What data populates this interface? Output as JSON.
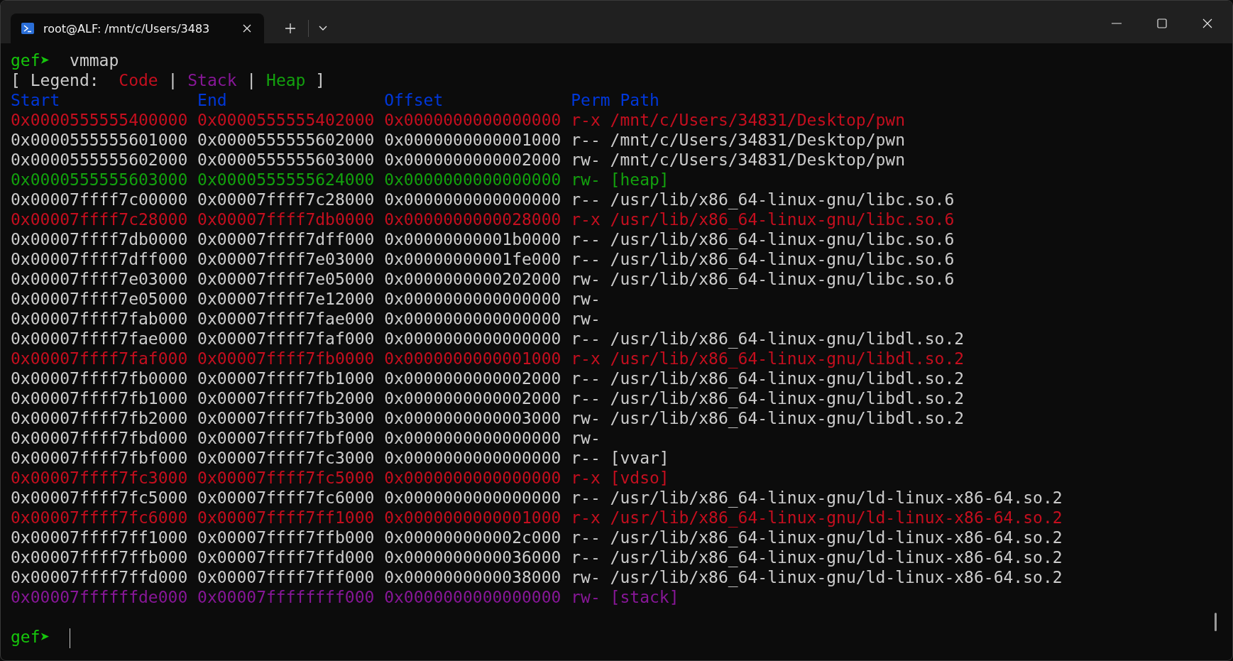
{
  "tab": {
    "title": "root@ALF: /mnt/c/Users/3483",
    "selected": true
  },
  "terminal": {
    "command_line": {
      "prompt": "gef➤",
      "command": "vmmap"
    },
    "legend": [
      {
        "text": "[ Legend:",
        "kind": "plain"
      },
      {
        "text": "Code",
        "kind": "code"
      },
      {
        "text": "|",
        "kind": "plain"
      },
      {
        "text": "Stack",
        "kind": "stack"
      },
      {
        "text": "|",
        "kind": "plain"
      },
      {
        "text": "Heap",
        "kind": "heap"
      },
      {
        "text": "]",
        "kind": "plain"
      }
    ],
    "columns": [
      "Start",
      "End",
      "Offset",
      "Perm",
      "Path"
    ],
    "rows": [
      {
        "start": "0x0000555555400000",
        "end": "0x0000555555402000",
        "offset": "0x0000000000000000",
        "perm": "r-x",
        "path": "/mnt/c/Users/34831/Desktop/pwn",
        "kind": "code"
      },
      {
        "start": "0x0000555555601000",
        "end": "0x0000555555602000",
        "offset": "0x0000000000001000",
        "perm": "r--",
        "path": "/mnt/c/Users/34831/Desktop/pwn",
        "kind": "plain"
      },
      {
        "start": "0x0000555555602000",
        "end": "0x0000555555603000",
        "offset": "0x0000000000002000",
        "perm": "rw-",
        "path": "/mnt/c/Users/34831/Desktop/pwn",
        "kind": "plain"
      },
      {
        "start": "0x0000555555603000",
        "end": "0x0000555555624000",
        "offset": "0x0000000000000000",
        "perm": "rw-",
        "path": "[heap]",
        "kind": "heap"
      },
      {
        "start": "0x00007ffff7c00000",
        "end": "0x00007ffff7c28000",
        "offset": "0x0000000000000000",
        "perm": "r--",
        "path": "/usr/lib/x86_64-linux-gnu/libc.so.6",
        "kind": "plain"
      },
      {
        "start": "0x00007ffff7c28000",
        "end": "0x00007ffff7db0000",
        "offset": "0x0000000000028000",
        "perm": "r-x",
        "path": "/usr/lib/x86_64-linux-gnu/libc.so.6",
        "kind": "code"
      },
      {
        "start": "0x00007ffff7db0000",
        "end": "0x00007ffff7dff000",
        "offset": "0x00000000001b0000",
        "perm": "r--",
        "path": "/usr/lib/x86_64-linux-gnu/libc.so.6",
        "kind": "plain"
      },
      {
        "start": "0x00007ffff7dff000",
        "end": "0x00007ffff7e03000",
        "offset": "0x00000000001fe000",
        "perm": "r--",
        "path": "/usr/lib/x86_64-linux-gnu/libc.so.6",
        "kind": "plain"
      },
      {
        "start": "0x00007ffff7e03000",
        "end": "0x00007ffff7e05000",
        "offset": "0x0000000000202000",
        "perm": "rw-",
        "path": "/usr/lib/x86_64-linux-gnu/libc.so.6",
        "kind": "plain"
      },
      {
        "start": "0x00007ffff7e05000",
        "end": "0x00007ffff7e12000",
        "offset": "0x0000000000000000",
        "perm": "rw-",
        "kind": "plain"
      },
      {
        "start": "0x00007ffff7fab000",
        "end": "0x00007ffff7fae000",
        "offset": "0x0000000000000000",
        "perm": "rw-",
        "kind": "plain"
      },
      {
        "start": "0x00007ffff7fae000",
        "end": "0x00007ffff7faf000",
        "offset": "0x0000000000000000",
        "perm": "r--",
        "path": "/usr/lib/x86_64-linux-gnu/libdl.so.2",
        "kind": "plain"
      },
      {
        "start": "0x00007ffff7faf000",
        "end": "0x00007ffff7fb0000",
        "offset": "0x0000000000001000",
        "perm": "r-x",
        "path": "/usr/lib/x86_64-linux-gnu/libdl.so.2",
        "kind": "code"
      },
      {
        "start": "0x00007ffff7fb0000",
        "end": "0x00007ffff7fb1000",
        "offset": "0x0000000000002000",
        "perm": "r--",
        "path": "/usr/lib/x86_64-linux-gnu/libdl.so.2",
        "kind": "plain"
      },
      {
        "start": "0x00007ffff7fb1000",
        "end": "0x00007ffff7fb2000",
        "offset": "0x0000000000002000",
        "perm": "r--",
        "path": "/usr/lib/x86_64-linux-gnu/libdl.so.2",
        "kind": "plain"
      },
      {
        "start": "0x00007ffff7fb2000",
        "end": "0x00007ffff7fb3000",
        "offset": "0x0000000000003000",
        "perm": "rw-",
        "path": "/usr/lib/x86_64-linux-gnu/libdl.so.2",
        "kind": "plain"
      },
      {
        "start": "0x00007ffff7fbd000",
        "end": "0x00007ffff7fbf000",
        "offset": "0x0000000000000000",
        "perm": "rw-",
        "kind": "plain"
      },
      {
        "start": "0x00007ffff7fbf000",
        "end": "0x00007ffff7fc3000",
        "offset": "0x0000000000000000",
        "perm": "r--",
        "path": "[vvar]",
        "kind": "plain"
      },
      {
        "start": "0x00007ffff7fc3000",
        "end": "0x00007ffff7fc5000",
        "offset": "0x0000000000000000",
        "perm": "r-x",
        "path": "[vdso]",
        "kind": "code"
      },
      {
        "start": "0x00007ffff7fc5000",
        "end": "0x00007ffff7fc6000",
        "offset": "0x0000000000000000",
        "perm": "r--",
        "path": "/usr/lib/x86_64-linux-gnu/ld-linux-x86-64.so.2",
        "kind": "plain"
      },
      {
        "start": "0x00007ffff7fc6000",
        "end": "0x00007ffff7ff1000",
        "offset": "0x0000000000001000",
        "perm": "r-x",
        "path": "/usr/lib/x86_64-linux-gnu/ld-linux-x86-64.so.2",
        "kind": "code"
      },
      {
        "start": "0x00007ffff7ff1000",
        "end": "0x00007ffff7ffb000",
        "offset": "0x000000000002c000",
        "perm": "r--",
        "path": "/usr/lib/x86_64-linux-gnu/ld-linux-x86-64.so.2",
        "kind": "plain"
      },
      {
        "start": "0x00007ffff7ffb000",
        "end": "0x00007ffff7ffd000",
        "offset": "0x0000000000036000",
        "perm": "r--",
        "path": "/usr/lib/x86_64-linux-gnu/ld-linux-x86-64.so.2",
        "kind": "plain"
      },
      {
        "start": "0x00007ffff7ffd000",
        "end": "0x00007ffff7fff000",
        "offset": "0x0000000000038000",
        "perm": "rw-",
        "path": "/usr/lib/x86_64-linux-gnu/ld-linux-x86-64.so.2",
        "kind": "plain"
      },
      {
        "start": "0x00007ffffffde000",
        "end": "0x00007ffffffff000",
        "offset": "0x0000000000000000",
        "perm": "rw-",
        "path": "[stack]",
        "kind": "stack"
      }
    ],
    "input_line": {
      "prompt": "gef➤"
    }
  }
}
